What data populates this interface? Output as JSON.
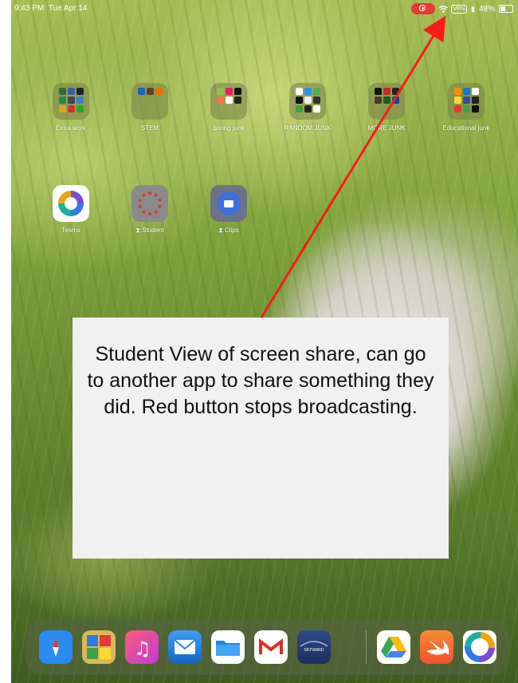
{
  "status_bar": {
    "time": "9:43 PM",
    "date": "Tue Apr 14",
    "vpn": "VPN",
    "battery": "48%",
    "recording_color": "#e53935"
  },
  "home": {
    "folders": [
      {
        "label": "Extra work"
      },
      {
        "label": "STEM"
      },
      {
        "label": "boring junk"
      },
      {
        "label": "RANDOM JUNK"
      },
      {
        "label": "MORE JUNK"
      },
      {
        "label": "Educational junk"
      }
    ],
    "apps": [
      {
        "label": "Teams",
        "icon": "teams-icon"
      },
      {
        "label": "⧗ Student",
        "icon": "canvas-student-icon"
      },
      {
        "label": "⧗ Clips",
        "icon": "clips-icon"
      }
    ]
  },
  "callout": {
    "text": "Student View of screen share, can go to another app to share something they did. Red button stops broadcasting.",
    "arrow_color": "#ff1a1a"
  },
  "dock": {
    "apps": [
      {
        "name": "Safari",
        "icon": "safari-icon"
      },
      {
        "name": "Photos",
        "icon": "puzzle-icon"
      },
      {
        "name": "Music",
        "icon": "music-icon"
      },
      {
        "name": "Mail",
        "icon": "mail-icon"
      },
      {
        "name": "Files",
        "icon": "files-icon"
      },
      {
        "name": "Gmail",
        "icon": "gmail-icon"
      },
      {
        "name": "Skyward",
        "icon": "skyward-icon",
        "text": "SKYWARD"
      },
      {
        "name": "Drive",
        "icon": "drive-icon"
      },
      {
        "name": "Swift",
        "icon": "swift-icon"
      },
      {
        "name": "Teams",
        "icon": "teams-icon"
      }
    ]
  }
}
